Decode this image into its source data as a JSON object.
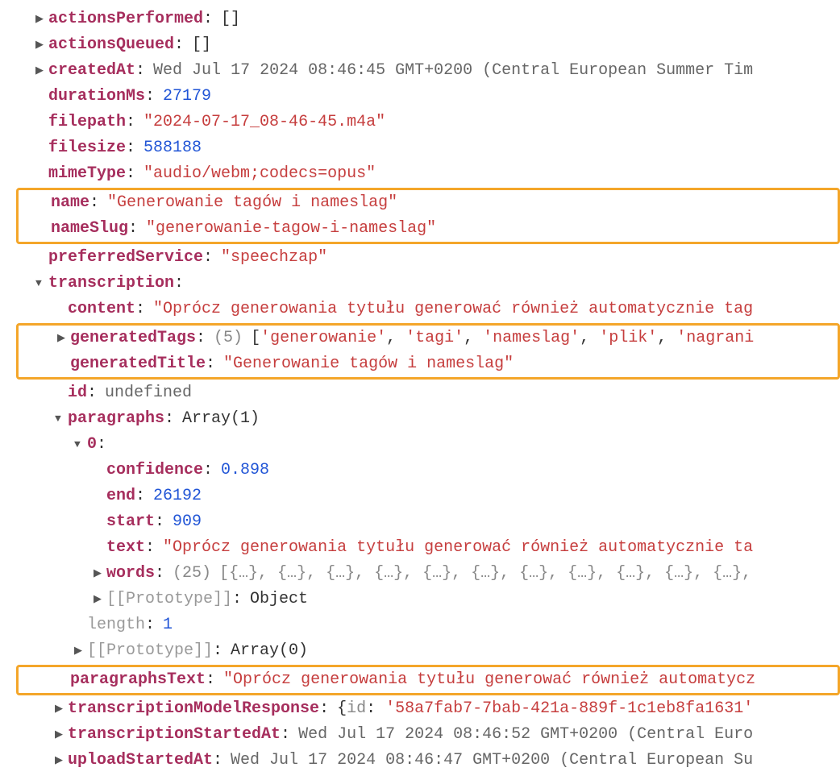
{
  "root": {
    "actionsPerformed": {
      "key": "actionsPerformed",
      "value": "[]"
    },
    "actionsQueued": {
      "key": "actionsQueued",
      "value": "[]"
    },
    "createdAt": {
      "key": "createdAt",
      "value": "Wed Jul 17 2024 08:46:45 GMT+0200 (Central European Summer Tim"
    },
    "durationMs": {
      "key": "durationMs",
      "value": "27179"
    },
    "filepath": {
      "key": "filepath",
      "value": "\"2024-07-17_08-46-45.m4a\""
    },
    "filesize": {
      "key": "filesize",
      "value": "588188"
    },
    "mimeType": {
      "key": "mimeType",
      "value": "\"audio/webm;codecs=opus\""
    },
    "name": {
      "key": "name",
      "value": "\"Generowanie tagów i nameslag\""
    },
    "nameSlug": {
      "key": "nameSlug",
      "value": "\"generowanie-tagow-i-nameslag\""
    },
    "preferredService": {
      "key": "preferredService",
      "value": "\"speechzap\""
    },
    "transcription": {
      "key": "transcription",
      "content": {
        "key": "content",
        "value": "\"Oprócz generowania tytułu generować również automatycznie tag"
      },
      "generatedTags": {
        "key": "generatedTags",
        "count": "(5)",
        "items": [
          "'generowanie'",
          "'tagi'",
          "'nameslag'",
          "'plik'",
          "'nagrani"
        ]
      },
      "generatedTitle": {
        "key": "generatedTitle",
        "value": "\"Generowanie tagów i nameslag\""
      },
      "id": {
        "key": "id",
        "value": "undefined"
      },
      "paragraphs": {
        "key": "paragraphs",
        "preview": "Array(1)",
        "item0": {
          "key": "0",
          "confidence": {
            "key": "confidence",
            "value": "0.898"
          },
          "end": {
            "key": "end",
            "value": "26192"
          },
          "start": {
            "key": "start",
            "value": "909"
          },
          "text": {
            "key": "text",
            "value": "\"Oprócz generowania tytułu generować również automatycznie ta"
          },
          "words": {
            "key": "words",
            "count": "(25)",
            "preview": "[{…}, {…}, {…}, {…}, {…}, {…}, {…}, {…}, {…}, {…}, {…},"
          },
          "proto": {
            "key": "[[Prototype]]",
            "value": "Object"
          }
        },
        "length": {
          "key": "length",
          "value": "1"
        },
        "proto": {
          "key": "[[Prototype]]",
          "value": "Array(0)"
        }
      },
      "paragraphsText": {
        "key": "paragraphsText",
        "value": "\"Oprócz generowania tytułu generować również automatycz"
      },
      "transcriptionModelResponse": {
        "key": "transcriptionModelResponse",
        "idKey": "id",
        "idVal": "'58a7fab7-7bab-421a-889f-1c1eb8fa1631'"
      },
      "transcriptionStartedAt": {
        "key": "transcriptionStartedAt",
        "value": "Wed Jul 17 2024 08:46:52 GMT+0200 (Central Euro"
      },
      "uploadStartedAt": {
        "key": "uploadStartedAt",
        "value": "Wed Jul 17 2024 08:46:47 GMT+0200 (Central European Su"
      }
    }
  }
}
